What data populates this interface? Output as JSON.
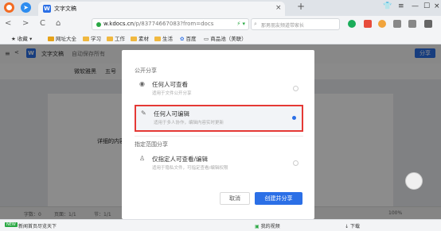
{
  "browser": {
    "tab_title": "文字文稿",
    "tab_close": "×",
    "tab_add": "+",
    "url_host": "w.kdocs.cn",
    "url_path": "/p/83774667083?from=docs",
    "search_placeholder": "那男朋友频道带家长",
    "nav_back": "<",
    "nav_forward": ">",
    "nav_reload": "C",
    "nav_home": "⌂",
    "window_controls": [
      "□",
      "—",
      "☐",
      "×"
    ]
  },
  "bookmarks": {
    "items": [
      "收藏",
      "网址大全",
      "学习",
      "工作",
      "素材",
      "生活",
      "百度",
      "商品池（美联）"
    ]
  },
  "app": {
    "title": "文字文稿",
    "autosave": "自动保存所有",
    "font_name": "微软雅黑",
    "font_size": "五号",
    "doc_text": "详细的内容",
    "share_button": "分享"
  },
  "dialog": {
    "section_public": "公开分享",
    "section_specified": "指定范围分享",
    "options": [
      {
        "title": "任何人可查看",
        "desc": "适用于文件公开分享",
        "icon": "eye-icon",
        "selected": false
      },
      {
        "title": "任何人可编辑",
        "desc": "适用于多人协作，编辑内容实时更新",
        "icon": "pencil-icon",
        "selected": true
      },
      {
        "title": "仅指定人可查看/编辑",
        "desc": "适用于隐私文件，可指定查看/编辑权限",
        "icon": "person-icon",
        "selected": false
      }
    ],
    "cancel_label": "取消",
    "create_label": "创建并分享"
  },
  "status": {
    "words": "字数：0",
    "page": "页面：1/1",
    "section": "节：1/1",
    "zoom": "100%"
  },
  "downloads": {
    "left_text": "新闻首页尽览天下",
    "video": "我的视频",
    "download": "下载"
  },
  "colors": {
    "accent": "#2b6fe6",
    "highlight_border": "#e53935"
  }
}
